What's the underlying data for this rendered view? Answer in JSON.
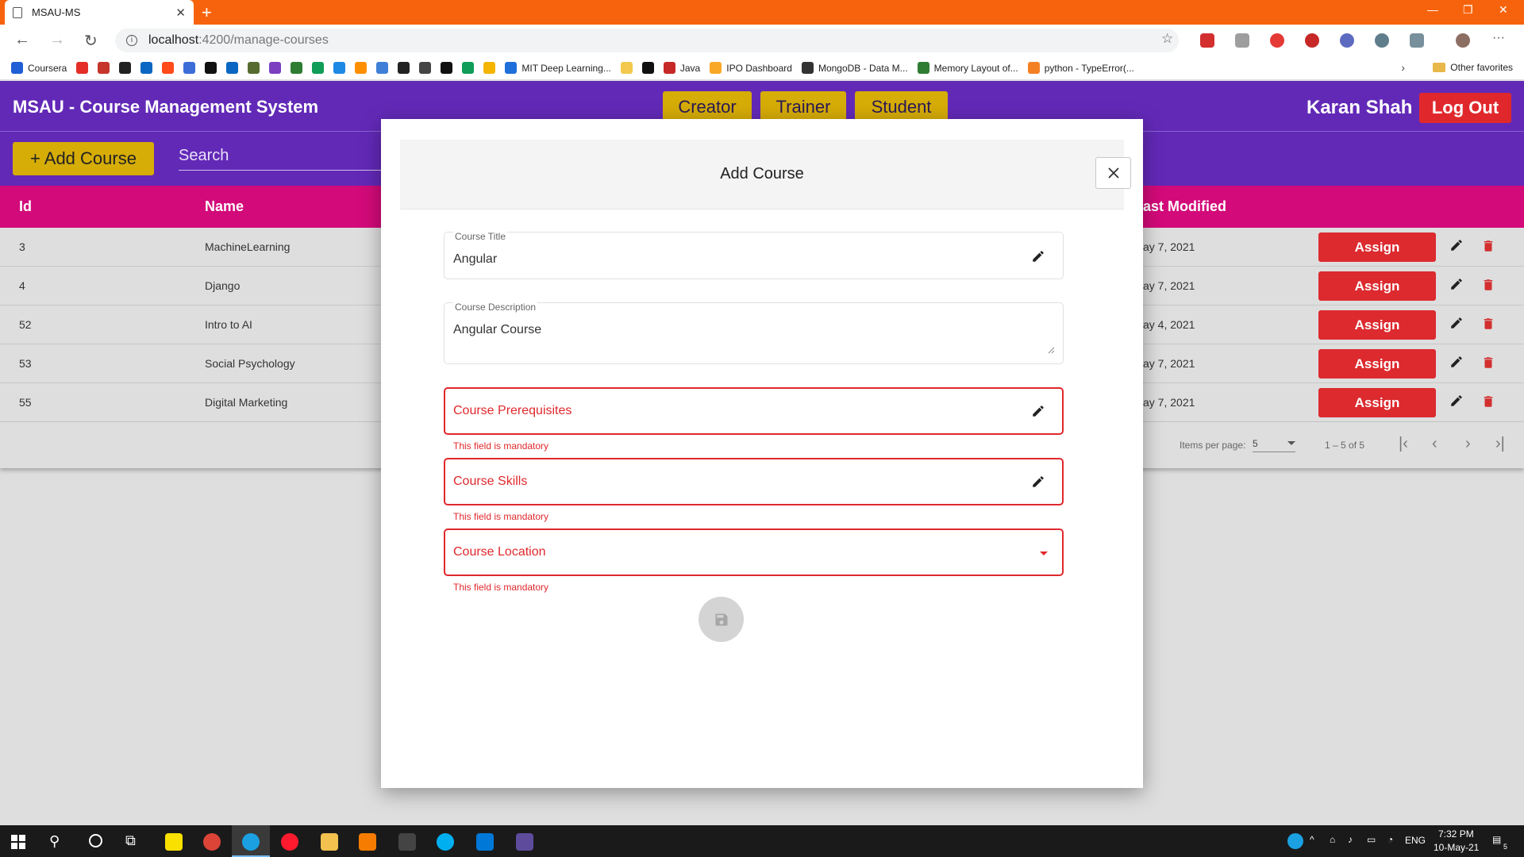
{
  "browser": {
    "tab_title": "MSAU-MS",
    "tab_close": "✕",
    "new_tab": "+",
    "url_host": "localhost",
    "url_path": ":4200/manage-courses",
    "bookmarks": [
      {
        "label": "Coursera",
        "color": "#1f5fd6"
      },
      {
        "label": "",
        "color": "#e52d27"
      },
      {
        "label": "",
        "color": "#c6352b"
      },
      {
        "label": "",
        "color": "#222222"
      },
      {
        "label": "",
        "color": "#0a66c2"
      },
      {
        "label": "",
        "color": "#ff4a1c"
      },
      {
        "label": "",
        "color": "#3b6cd8"
      },
      {
        "label": "",
        "color": "#111111"
      },
      {
        "label": "",
        "color": "#0a66c2"
      },
      {
        "label": "",
        "color": "#556b2f"
      },
      {
        "label": "",
        "color": "#7b3fbf"
      },
      {
        "label": "",
        "color": "#2e7d32"
      },
      {
        "label": "",
        "color": "#0f9d58"
      },
      {
        "label": "",
        "color": "#1e88e5"
      },
      {
        "label": "",
        "color": "#ff8f00"
      },
      {
        "label": "",
        "color": "#3f7fd8"
      },
      {
        "label": "",
        "color": "#222222"
      },
      {
        "label": "",
        "color": "#444444"
      },
      {
        "label": "",
        "color": "#111111"
      },
      {
        "label": "",
        "color": "#0f9d58"
      },
      {
        "label": "",
        "color": "#f4b400"
      },
      {
        "label": "MIT Deep Learning...",
        "color": "#1e6fd9"
      },
      {
        "label": "",
        "color": "#f2c94c"
      },
      {
        "label": "",
        "color": "#111111"
      },
      {
        "label": "Java",
        "color": "#c62828"
      },
      {
        "label": "IPO Dashboard",
        "color": "#f9a825"
      },
      {
        "label": "MongoDB - Data M...",
        "color": "#333333"
      },
      {
        "label": "Memory Layout of...",
        "color": "#2e7d32"
      },
      {
        "label": "python - TypeError(...",
        "color": "#f48024"
      }
    ],
    "other_favorites": "Other favorites"
  },
  "app": {
    "title": "MSAU - Course Management System",
    "roles": [
      "Creator",
      "Trainer",
      "Student"
    ],
    "user_name": "Karan Shah",
    "logout_label": "Log Out",
    "add_course_label": "+ Add Course",
    "search_placeholder": "Search"
  },
  "table": {
    "headers": {
      "id": "Id",
      "name": "Name",
      "last_modified": "ast Modified"
    },
    "rows": [
      {
        "id": "3",
        "name": "MachineLearning",
        "last_modified": "ay 7, 2021",
        "assign": "Assign"
      },
      {
        "id": "4",
        "name": "Django",
        "last_modified": "ay 7, 2021",
        "assign": "Assign"
      },
      {
        "id": "52",
        "name": "Intro to AI",
        "last_modified": "ay 4, 2021",
        "assign": "Assign"
      },
      {
        "id": "53",
        "name": "Social Psychology",
        "last_modified": "ay 7, 2021",
        "assign": "Assign"
      },
      {
        "id": "55",
        "name": "Digital Marketing",
        "last_modified": "ay 7, 2021",
        "assign": "Assign"
      }
    ],
    "paginator": {
      "items_per_page_label": "Items per page:",
      "items_per_page_value": "5",
      "range_label": "1 – 5 of 5"
    }
  },
  "modal": {
    "title": "Add Course",
    "fields": {
      "title": {
        "label": "Course Title",
        "value": "Angular"
      },
      "description": {
        "label": "Course Description",
        "value": "Angular Course"
      },
      "prerequisites": {
        "placeholder": "Course Prerequisites",
        "error": "This field is mandatory"
      },
      "skills": {
        "placeholder": "Course Skills",
        "error": "This field is mandatory"
      },
      "location": {
        "placeholder": "Course Location",
        "error": "This field is mandatory"
      }
    }
  },
  "taskbar": {
    "language": "ENG",
    "time": "7:32 PM",
    "date": "10-May-21",
    "notifications": "5"
  },
  "colors": {
    "header_purple": "#6229b7",
    "table_header_magenta": "#d30a7a",
    "role_gold": "#d6ac07",
    "danger_red": "#e0282c"
  }
}
